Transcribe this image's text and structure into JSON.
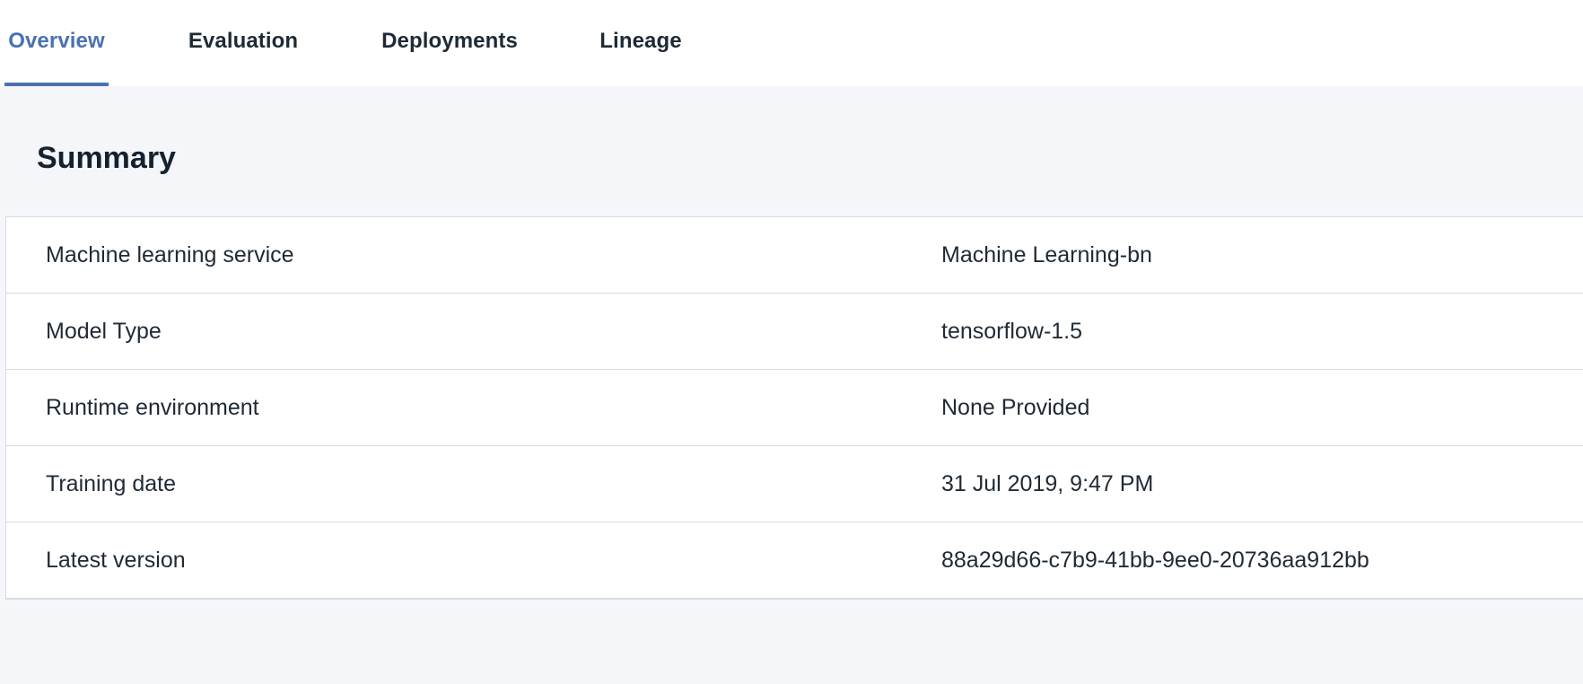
{
  "tabs": {
    "overview": "Overview",
    "evaluation": "Evaluation",
    "deployments": "Deployments",
    "lineage": "Lineage",
    "active": "overview"
  },
  "summary": {
    "title": "Summary",
    "rows": [
      {
        "label": "Machine learning service",
        "value": "Machine Learning-bn"
      },
      {
        "label": "Model Type",
        "value": "tensorflow-1.5"
      },
      {
        "label": "Runtime environment",
        "value": "None Provided"
      },
      {
        "label": "Training date",
        "value": "31 Jul 2019, 9:47 PM"
      },
      {
        "label": "Latest version",
        "value": "88a29d66-c7b9-41bb-9ee0-20736aa912bb"
      }
    ]
  },
  "colors": {
    "accent": "#4a72b2",
    "page_background": "#f4f6f9",
    "border": "#d6dbe1",
    "text": "#1f2a36"
  }
}
